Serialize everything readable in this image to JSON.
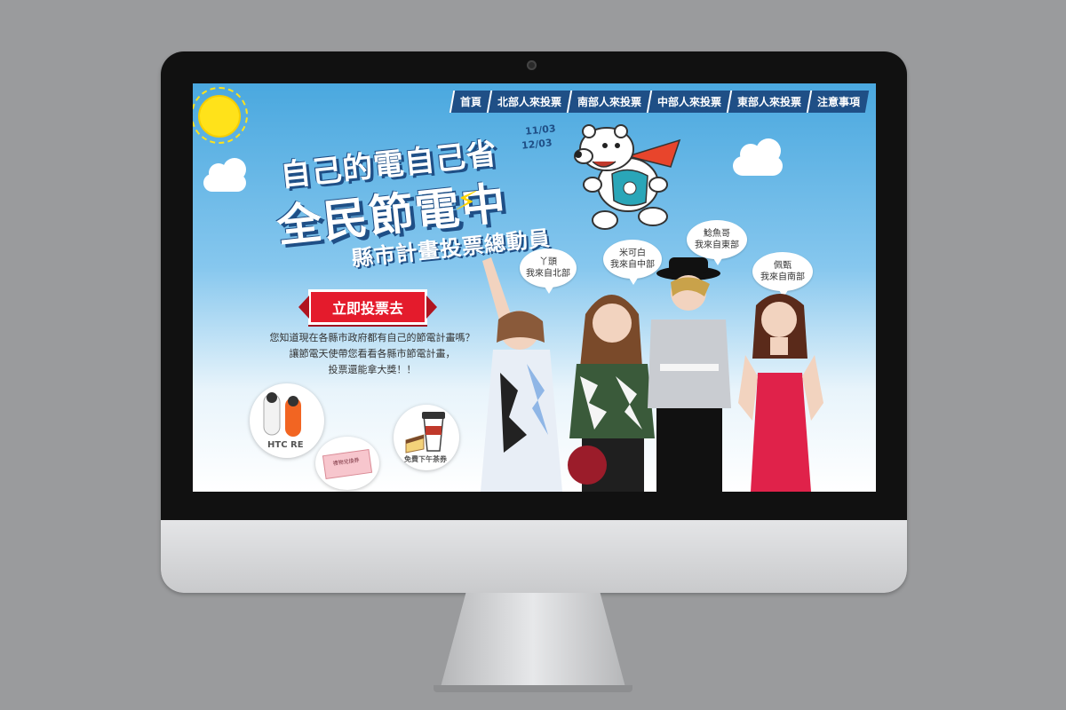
{
  "nav": {
    "items": [
      {
        "label": "首頁"
      },
      {
        "label": "北部人來投票"
      },
      {
        "label": "南部人來投票"
      },
      {
        "label": "中部人來投票"
      },
      {
        "label": "東部人來投票"
      },
      {
        "label": "注意事項"
      }
    ]
  },
  "hero": {
    "title_line1": "自己的電自己省",
    "title_line2": "全民節電中",
    "title_line3": "縣市計畫投票總動員",
    "date_start": "11/03",
    "date_end": "12/03"
  },
  "cta": {
    "vote_label": "立即投票去"
  },
  "description": {
    "line1": "您知道現在各縣市政府都有自己的節電計畫嗎？",
    "line2": "讓節電天使帶您看看各縣市節電計畫，",
    "line3": "投票還能拿大獎！！"
  },
  "prizes": {
    "camera_label": "HTC RE",
    "coffee_label": "免費下午茶券",
    "coupon_label": "禮物兌換券"
  },
  "bubbles": [
    {
      "name": "丫頭",
      "region": "我來自北部"
    },
    {
      "name": "米可白",
      "region": "我來自中部"
    },
    {
      "name": "鯰魚哥",
      "region": "我來自東部"
    },
    {
      "name": "佩甄",
      "region": "我來自南部"
    }
  ],
  "colors": {
    "sky_top": "#4aa8df",
    "nav_bg": "#1f4f86",
    "cta_red": "#e41b2c",
    "sun_yellow": "#ffe21a"
  }
}
